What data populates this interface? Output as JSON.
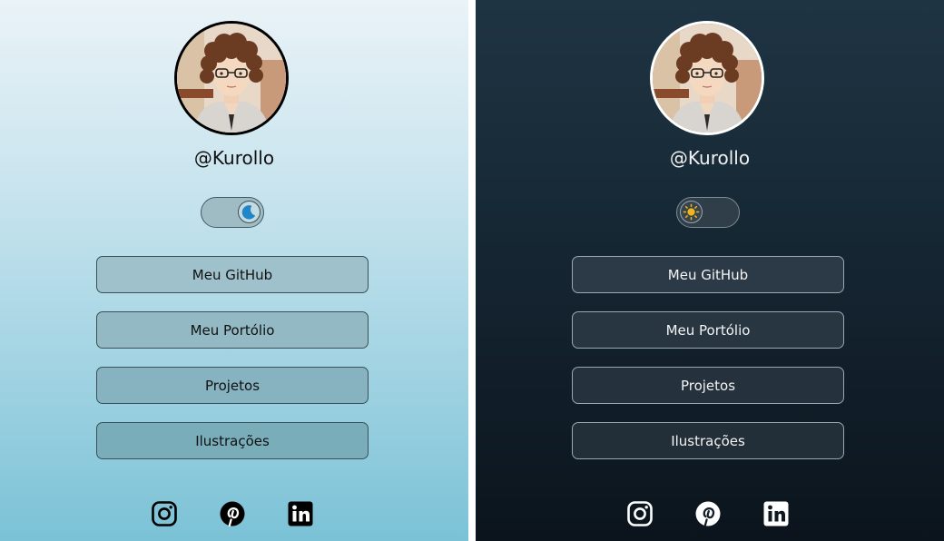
{
  "profile": {
    "username": "@Kurollo"
  },
  "theme_toggle": {
    "light_icon": "moon-icon",
    "dark_icon": "sun-icon"
  },
  "links": [
    {
      "label": "Meu GitHub"
    },
    {
      "label": "Meu Portólio"
    },
    {
      "label": "Projetos"
    },
    {
      "label": "Ilustrações"
    }
  ],
  "social": [
    {
      "icon": "instagram-icon"
    },
    {
      "icon": "pinterest-icon"
    },
    {
      "icon": "linkedin-icon"
    }
  ],
  "colors": {
    "light_bg_top": "#eaf3f7",
    "light_bg_bottom": "#7bc2d6",
    "dark_bg_top": "#1f3443",
    "dark_bg_bottom": "#0b141c",
    "moon": "#1f86c9",
    "sun": "#f2b41a"
  }
}
